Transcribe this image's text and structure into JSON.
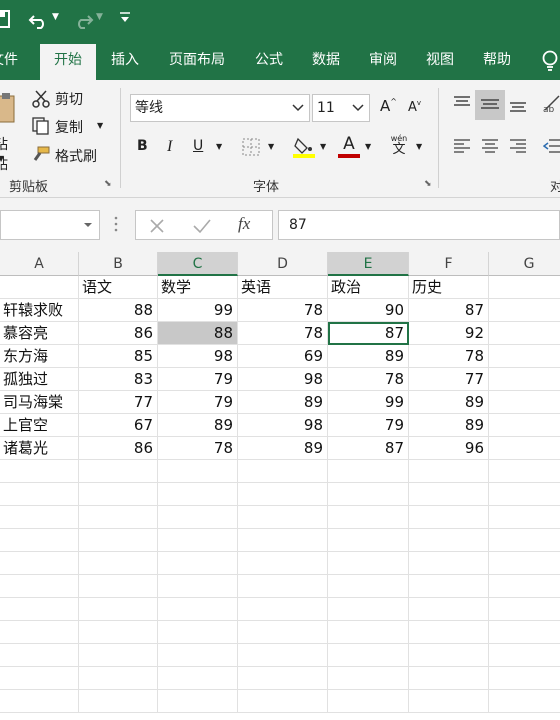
{
  "titlebar": {
    "save_icon": "save-icon",
    "undo_icon": "undo-icon",
    "redo_icon": "redo-icon",
    "customize_icon": "customize-qat-icon"
  },
  "tabs": [
    {
      "label": "文件"
    },
    {
      "label": "开始"
    },
    {
      "label": "插入"
    },
    {
      "label": "页面布局"
    },
    {
      "label": "公式"
    },
    {
      "label": "数据"
    },
    {
      "label": "审阅"
    },
    {
      "label": "视图"
    },
    {
      "label": "帮助"
    }
  ],
  "ribbon": {
    "paste": "粘贴",
    "cut": "剪切",
    "copy": "复制",
    "format_painter": "格式刷",
    "clipboard_group": "剪贴板",
    "font_name": "等线",
    "font_size": "11",
    "bold": "B",
    "italic": "I",
    "underline": "U",
    "grow_font": "A",
    "shrink_font": "A",
    "font_color_letter": "A",
    "wen": "文",
    "wen_small": "wén",
    "font_group": "字体",
    "align_group_partial": "对"
  },
  "formula": {
    "fx": "fx",
    "value": "87"
  },
  "columns": [
    "A",
    "B",
    "C",
    "D",
    "E",
    "F",
    "G"
  ],
  "headers": [
    "",
    "语文",
    "数学",
    "英语",
    "政治",
    "历史"
  ],
  "rows": [
    [
      "轩辕求败",
      "88",
      "99",
      "78",
      "90",
      "87"
    ],
    [
      "慕容亮",
      "86",
      "88",
      "78",
      "87",
      "92"
    ],
    [
      "东方海",
      "85",
      "98",
      "69",
      "89",
      "78"
    ],
    [
      "孤独过",
      "83",
      "79",
      "98",
      "78",
      "77"
    ],
    [
      "司马海棠",
      "77",
      "79",
      "89",
      "99",
      "89"
    ],
    [
      "上官空",
      "67",
      "89",
      "98",
      "79",
      "89"
    ],
    [
      "诸葛光",
      "86",
      "78",
      "89",
      "87",
      "96"
    ]
  ],
  "colors": {
    "brand": "#217346",
    "selected_fill": "#c8c8c8",
    "font_color": "#c00000",
    "highlight": "#ffff00"
  }
}
